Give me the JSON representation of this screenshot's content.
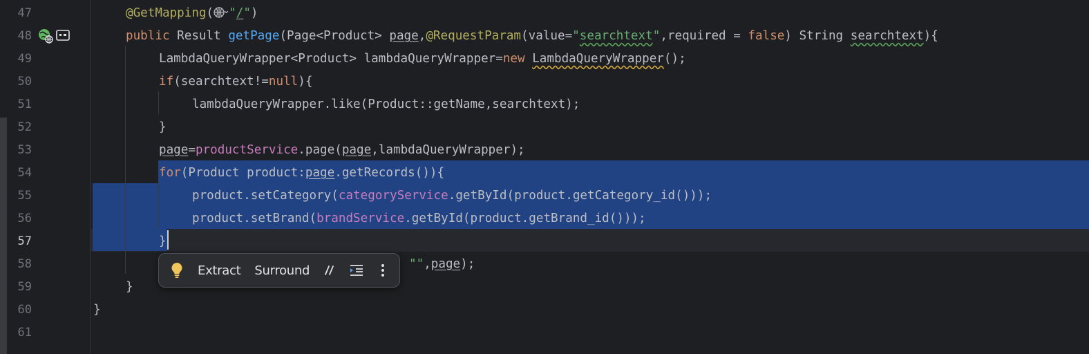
{
  "editor": {
    "line_numbers": [
      "47",
      "48",
      "49",
      "50",
      "51",
      "52",
      "53",
      "54",
      "55",
      "56",
      "57",
      "58",
      "59",
      "60",
      "61"
    ],
    "current_line": "57",
    "colors": {
      "background": "#1e1f22",
      "selection": "#214283",
      "keyword": "#cf8e6d",
      "annotation": "#b3ae60",
      "string": "#6aab73",
      "field": "#c77dbb",
      "method_declaration": "#56a8f5",
      "default_text": "#bcbec4"
    },
    "code": {
      "l47": {
        "annotation": "@GetMapping",
        "open": "(",
        "quote1": "\"",
        "path": "/",
        "quote2": "\"",
        "close": ")"
      },
      "l48": {
        "kw_public": "public",
        "type": " Result ",
        "method": "getPage",
        "p1": "(Page<Product> ",
        "param_page": "page",
        "comma": ",",
        "annotation": "@RequestParam",
        "p2": "(value=",
        "str_open": "\"",
        "str_value": "searchtext",
        "str_close": "\"",
        "p3": ",required = ",
        "kw_false": "false",
        "p4": ") String ",
        "param_search": "searchtext",
        "p5": "){"
      },
      "l49": {
        "p1": "LambdaQueryWrapper<Product> lambdaQueryWrapper=",
        "kw_new": "new",
        "p2": " ",
        "ctor": "LambdaQueryWrapper",
        "p3": "();"
      },
      "l50": {
        "kw_if": "if",
        "p1": "(searchtext!=",
        "kw_null": "null",
        "p2": "){"
      },
      "l51": {
        "text": "lambdaQueryWrapper.like(Product::getName,searchtext);"
      },
      "l52": {
        "text": "}"
      },
      "l53": {
        "var_page": "page",
        "eq": "=",
        "field": "productService",
        "p1": ".page(",
        "arg_page": "page",
        "p2": ",lambdaQueryWrapper);"
      },
      "l54": {
        "kw_for": "for",
        "p1": "(Product product:",
        "var_page": "page",
        "p2": ".getRecords()){"
      },
      "l55": {
        "p1": "product.setCategory(",
        "field": "categoryService",
        "p2": ".getById(product.getCategory_id()));"
      },
      "l56": {
        "p1": "product.setBrand(",
        "field": "brandService",
        "p2": ".getById(product.getBrand_id()));"
      },
      "l57": {
        "text": "}"
      },
      "l58": {
        "p1": "\"\"",
        "p2": ",",
        "var_page": "page",
        "p3": ");"
      },
      "l59": {
        "text": "}"
      },
      "l60": {
        "text": "}"
      },
      "l61": {
        "text": ""
      }
    }
  },
  "gutter_icons": [
    "web-endpoint-icon",
    "spring-bean-icon"
  ],
  "floating_toolbar": {
    "items": [
      {
        "name": "lightbulb-icon"
      },
      {
        "label": "Extract"
      },
      {
        "label": "Surround"
      },
      {
        "name": "comment-icon"
      },
      {
        "name": "reformat-icon"
      },
      {
        "name": "more-vertical-icon"
      }
    ],
    "extract_label": "Extract",
    "surround_label": "Surround"
  }
}
